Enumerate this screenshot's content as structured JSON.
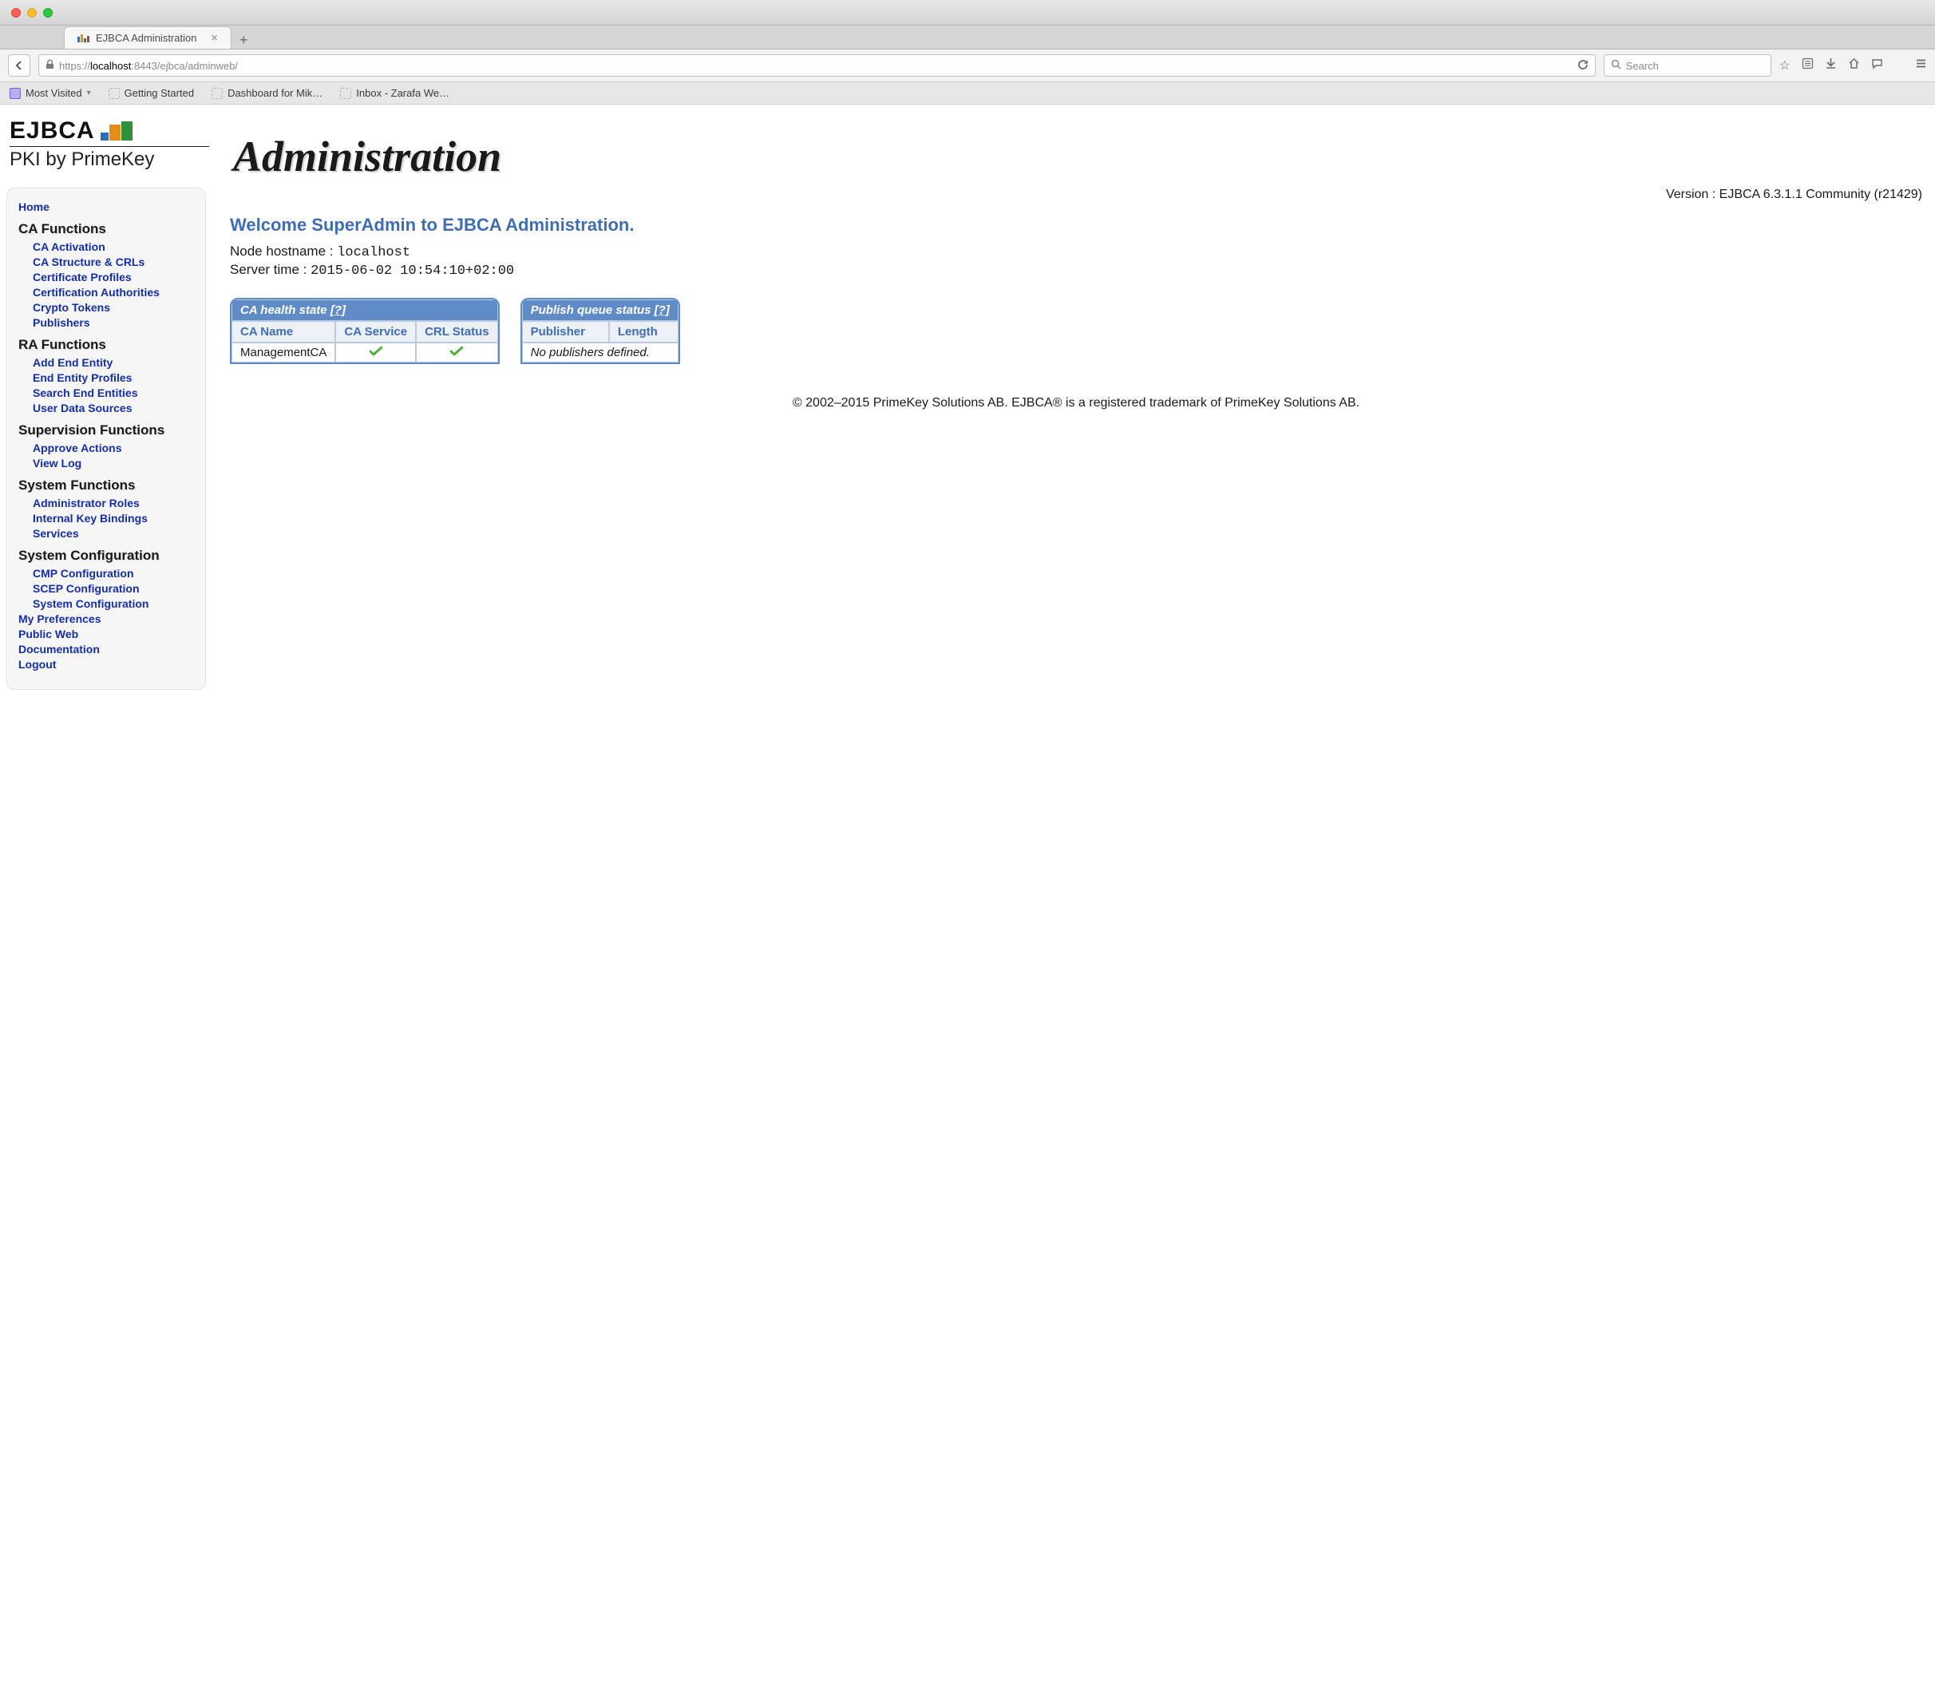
{
  "browser": {
    "tab_title": "EJBCA Administration",
    "url_scheme": "https://",
    "url_host": "localhost",
    "url_port_path": ":8443/ejbca/adminweb/",
    "search_placeholder": "Search",
    "bookmarks": [
      "Most Visited",
      "Getting Started",
      "Dashboard for Mik…",
      "Inbox - Zarafa We…"
    ]
  },
  "logo": {
    "top": "EJBCA",
    "sub": "PKI by PrimeKey"
  },
  "page_title": "Administration",
  "version_line": "Version : EJBCA 6.3.1.1 Community (r21429)",
  "welcome": "Welcome SuperAdmin to EJBCA Administration.",
  "hostname_label": "Node hostname : ",
  "hostname_value": "localhost",
  "servertime_label": "Server time : ",
  "servertime_value": "2015-06-02 10:54:10+02:00",
  "sidebar": {
    "home": "Home",
    "sections": [
      {
        "title": "CA Functions",
        "items": [
          "CA Activation",
          "CA Structure & CRLs",
          "Certificate Profiles",
          "Certification Authorities",
          "Crypto Tokens",
          "Publishers"
        ]
      },
      {
        "title": "RA Functions",
        "items": [
          "Add End Entity",
          "End Entity Profiles",
          "Search End Entities",
          "User Data Sources"
        ]
      },
      {
        "title": "Supervision Functions",
        "items": [
          "Approve Actions",
          "View Log"
        ]
      },
      {
        "title": "System Functions",
        "items": [
          "Administrator Roles",
          "Internal Key Bindings",
          "Services"
        ]
      },
      {
        "title": "System Configuration",
        "items": [
          "CMP Configuration",
          "SCEP Configuration",
          "System Configuration"
        ]
      }
    ],
    "footer_links": [
      "My Preferences",
      "Public Web",
      "Documentation",
      "Logout"
    ]
  },
  "table_health": {
    "caption": "CA health state ",
    "help": "[?]",
    "headers": [
      "CA Name",
      "CA Service",
      "CRL Status"
    ],
    "rows": [
      {
        "name": "ManagementCA",
        "service": "ok",
        "crl": "ok"
      }
    ]
  },
  "table_queue": {
    "caption": "Publish queue status ",
    "help": "[?]",
    "headers": [
      "Publisher",
      "Length"
    ],
    "empty": "No publishers defined."
  },
  "footer": "© 2002–2015 PrimeKey Solutions AB. EJBCA® is a registered trademark of PrimeKey Solutions AB."
}
